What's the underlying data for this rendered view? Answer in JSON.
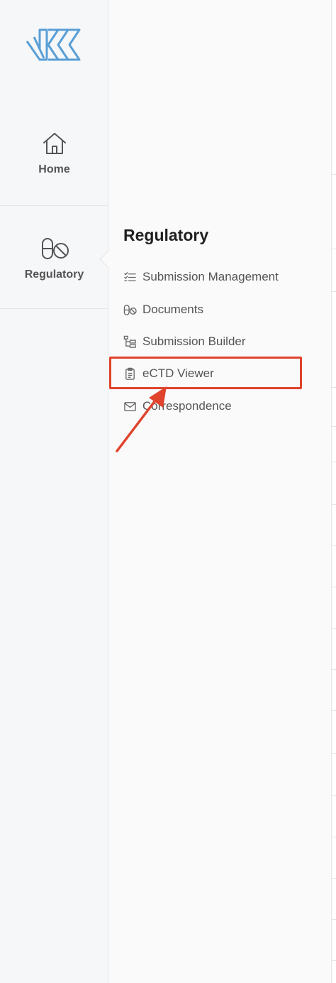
{
  "rail": {
    "logo_icon": "app-logo",
    "items": [
      {
        "label": "Home",
        "icon": "home-icon"
      },
      {
        "label": "Regulatory",
        "icon": "pill-icon",
        "active": true
      }
    ]
  },
  "panel": {
    "title": "Regulatory",
    "items": [
      {
        "label": "Submission Management",
        "icon": "checklist-icon"
      },
      {
        "label": "Documents",
        "icon": "pill-icon"
      },
      {
        "label": "Submission Builder",
        "icon": "tree-icon"
      },
      {
        "label": "eCTD Viewer",
        "icon": "clipboard-icon",
        "highlighted": true
      },
      {
        "label": "Correspondence",
        "icon": "mail-icon"
      }
    ]
  },
  "colors": {
    "accent": "#5a9fd6",
    "annotation": "#e0432c",
    "text": "#555555"
  }
}
